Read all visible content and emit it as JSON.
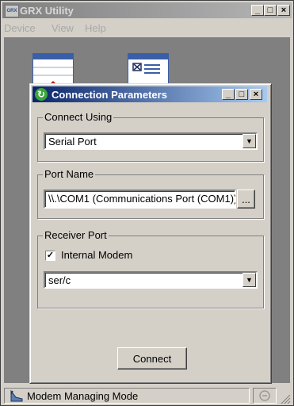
{
  "app": {
    "title": "GRX Utility",
    "icon_text": "GRX",
    "menu": [
      "Device",
      "View",
      "Help"
    ]
  },
  "status": {
    "text": "Modem Managing Mode"
  },
  "dialog": {
    "title": "Connection Parameters",
    "connect_using": {
      "label": "Connect Using",
      "value": "Serial Port"
    },
    "port_name": {
      "label": "Port Name",
      "value": "\\\\.\\COM1 (Communications Port (COM1))",
      "browse_label": "..."
    },
    "receiver_port": {
      "label": "Receiver Port",
      "internal_modem_label": "Internal Modem",
      "internal_modem_checked": true,
      "value": "ser/c"
    },
    "connect_label": "Connect"
  },
  "colors": {
    "dialog_title_start": "#0a246a",
    "dialog_title_end": "#a6caf0",
    "face": "#d4d0c8",
    "workspace": "#808080"
  }
}
